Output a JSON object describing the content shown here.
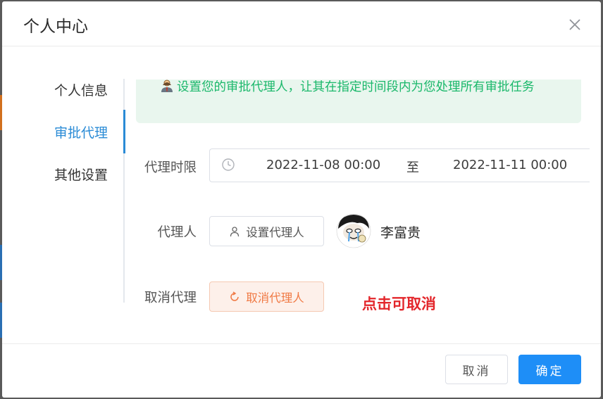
{
  "dialog": {
    "title": "个人中心",
    "close_icon": "close-icon"
  },
  "tabs": [
    {
      "label": "个人信息",
      "active": false
    },
    {
      "label": "审批代理",
      "active": true
    },
    {
      "label": "其他设置",
      "active": false
    }
  ],
  "banner": {
    "icon": "agent-person-icon",
    "text": "设置您的审批代理人，让其在指定时间段内为您处理所有审批任务"
  },
  "form": {
    "period_label": "代理时限",
    "date_range": {
      "icon": "clock-icon",
      "start": "2022-11-08 00:00",
      "separator": "至",
      "end": "2022-11-11 00:00"
    },
    "agent_label": "代理人",
    "set_agent_button": "设置代理人",
    "set_agent_icon": "user-icon",
    "agent_name": "李富贵",
    "cancel_label": "取消代理",
    "cancel_agent_button": "取消代理人",
    "cancel_agent_icon": "refresh-icon",
    "hint": "点击可取消"
  },
  "footer": {
    "cancel": "取消",
    "confirm": "确定"
  },
  "colors": {
    "accent": "#2a8bd6",
    "primary_button": "#1e8ef7",
    "banner_bg": "#e9f6ee",
    "banner_text": "#1bb86b",
    "warning_text": "#f07a45",
    "hint_text": "#e3262b"
  }
}
